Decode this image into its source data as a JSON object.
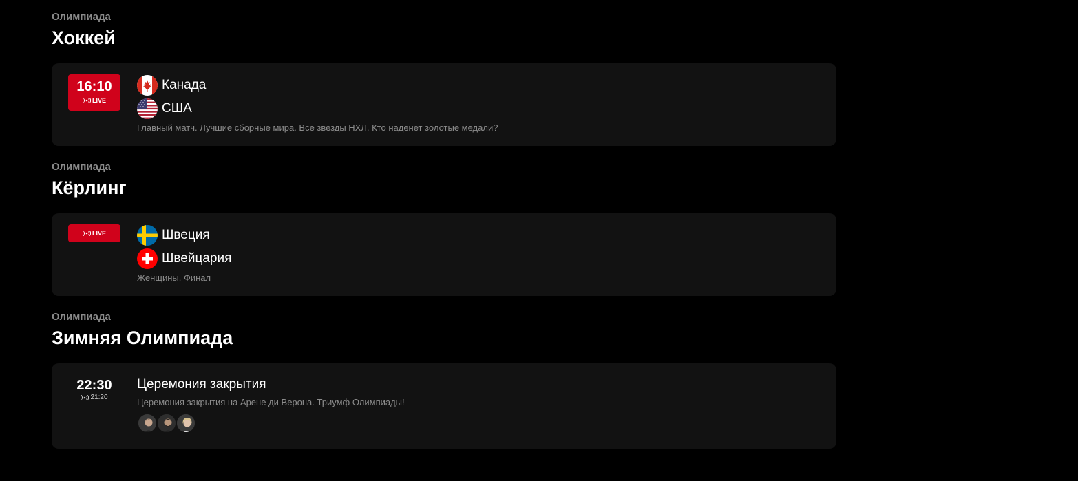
{
  "sections": [
    {
      "category": "Олимпиада",
      "title": "Хоккей",
      "card": {
        "time": "16:10",
        "live_label": "LIVE",
        "teams": [
          {
            "name": "Канада",
            "flag": "canada-flag-icon"
          },
          {
            "name": "США",
            "flag": "usa-flag-icon"
          }
        ],
        "description": "Главный матч. Лучшие сборные мира. Все звезды НХЛ. Кто наденет золотые медали?"
      }
    },
    {
      "category": "Олимпиада",
      "title": "Кёрлинг",
      "card": {
        "live_label": "LIVE",
        "teams": [
          {
            "name": "Швеция",
            "flag": "sweden-flag-icon"
          },
          {
            "name": "Швейцария",
            "flag": "switzerland-flag-icon"
          }
        ],
        "description": "Женщины. Финал"
      }
    },
    {
      "category": "Олимпиада",
      "title": "Зимняя Олимпиада",
      "card": {
        "time": "22:30",
        "broadcast_time": "21:20",
        "event_title": "Церемония закрытия",
        "description": "Церемония закрытия на Арене ди Верона. Триумф Олимпиады!",
        "commentators": [
          "avatar-commentator-1",
          "avatar-commentator-2",
          "avatar-commentator-3"
        ]
      }
    }
  ],
  "colors": {
    "background": "#000000",
    "card": "#121212",
    "live_red": "#d0021b",
    "muted_text": "#8c8c8c"
  }
}
